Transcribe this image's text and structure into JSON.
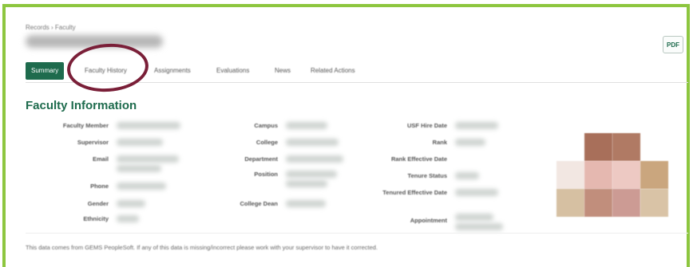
{
  "breadcrumb": "Records › Faculty",
  "export_label": "PDF",
  "tabs": [
    {
      "label": "Summary",
      "active": true
    },
    {
      "label": "Faculty History",
      "active": false
    },
    {
      "label": "Assignments",
      "active": false
    },
    {
      "label": "Evaluations",
      "active": false
    },
    {
      "label": "News",
      "active": false
    },
    {
      "label": "Related Actions",
      "active": false
    }
  ],
  "section_title": "Faculty Information",
  "fields": {
    "col1": [
      "Faculty Member",
      "Supervisor",
      "Email",
      "Phone",
      "Gender",
      "Ethnicity"
    ],
    "col2": [
      "Campus",
      "College",
      "Department",
      "Position",
      "College Dean"
    ],
    "col3": [
      "USF Hire Date",
      "Rank",
      "Rank Effective Date",
      "Tenure Status",
      "Tenured Effective Date",
      "Appointment"
    ]
  },
  "footer_note": "This data comes from GEMS PeopleSoft. If any of this data is missing/incorrect please work with your supervisor to have it corrected.",
  "colors": {
    "frame": "#8dc63f",
    "brand_green": "#1e6b4d",
    "annotation": "#7a1f38"
  }
}
